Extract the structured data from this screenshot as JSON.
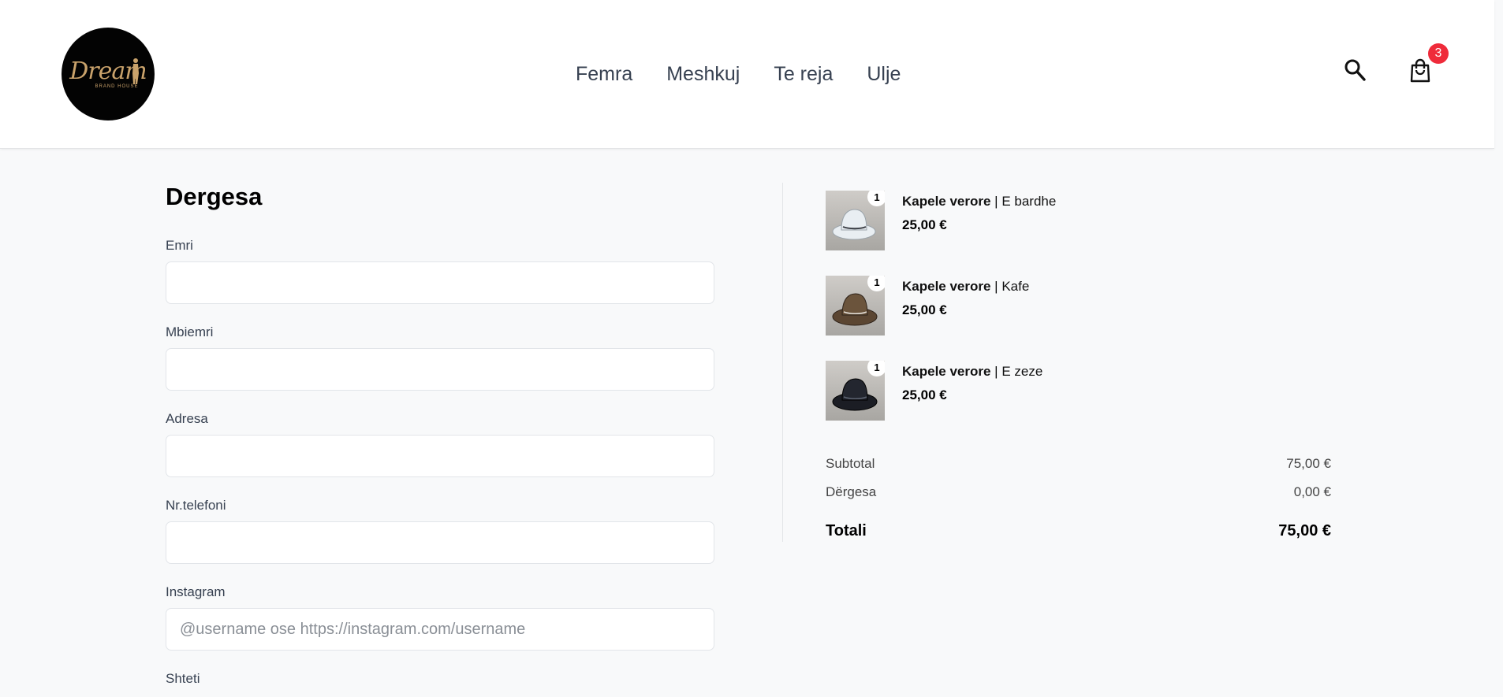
{
  "logo": {
    "main": "Dream",
    "sub": "BRAND HOUSE"
  },
  "nav": [
    "Femra",
    "Meshkuj",
    "Te reja",
    "Ulje"
  ],
  "cart": {
    "count": "3"
  },
  "form": {
    "title": "Dergesa",
    "fields": [
      {
        "label": "Emri",
        "value": "",
        "placeholder": ""
      },
      {
        "label": "Mbiemri",
        "value": "",
        "placeholder": ""
      },
      {
        "label": "Adresa",
        "value": "",
        "placeholder": ""
      },
      {
        "label": "Nr.telefoni",
        "value": "",
        "placeholder": ""
      },
      {
        "label": "Instagram",
        "value": "",
        "placeholder": "@username ose https://instagram.com/username"
      },
      {
        "label": "Shteti",
        "value": "",
        "placeholder": ""
      }
    ]
  },
  "items": [
    {
      "name": "Kapele verore",
      "sep": " | ",
      "variant": "E bardhe",
      "price": "25,00 €",
      "qty": "1",
      "hat_color": "#e9eef2"
    },
    {
      "name": "Kapele verore",
      "sep": " | ",
      "variant": "Kafe",
      "price": "25,00 €",
      "qty": "1",
      "hat_color": "#5b4632"
    },
    {
      "name": "Kapele verore",
      "sep": " | ",
      "variant": "E zeze",
      "price": "25,00 €",
      "qty": "1",
      "hat_color": "#1b1d24"
    }
  ],
  "totals": {
    "subtotal_label": "Subtotal",
    "subtotal": "75,00 €",
    "shipping_label": "Dërgesa",
    "shipping": "0,00 €",
    "total_label": "Totali",
    "total": "75,00 €"
  },
  "colors": {
    "accent_badge": "#ef2b3a",
    "logo_gold": "#c9a26b"
  }
}
